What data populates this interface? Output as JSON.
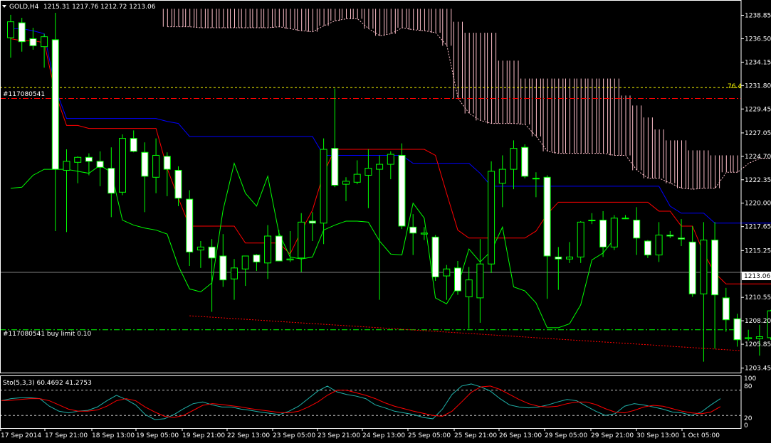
{
  "header": {
    "symbol": "GOLD,H4",
    "ohlc": "1215.31 1217.76 1212.72 1213.06"
  },
  "orders": {
    "sell_label": "#117080541",
    "buy_label": "#117080541 buy limit 0.10",
    "fib_label": "76.4"
  },
  "stoch": {
    "label": "Sto(5,3,3) 60.4692 41.2753",
    "levels": [
      100,
      80,
      20,
      0
    ]
  },
  "current_price": "1213.06",
  "colors": {
    "bull": "#00ff00",
    "bear_body": "#ffffff",
    "tenkan": "#ff0000",
    "kijun": "#0000ff",
    "chikou": "#00ff00",
    "kumo": "#ffc0cb",
    "grid_line": "#808080",
    "stoch_main": "#20b2aa",
    "stoch_signal": "#ff0000"
  },
  "chart_data": [
    {
      "type": "candlestick",
      "title": "GOLD,H4",
      "y_axis_labels": [
        "1238.85",
        "1236.50",
        "1234.15",
        "1231.80",
        "1229.45",
        "1227.05",
        "1224.70",
        "1222.35",
        "1220.00",
        "1217.65",
        "1215.25",
        "1213.06",
        "1210.55",
        "1208.20",
        "1205.85",
        "1203.45"
      ],
      "x_axis_labels": [
        "17 Sep 2014",
        "17 Sep 21:00",
        "18 Sep 13:00",
        "19 Sep 05:00",
        "19 Sep 21:00",
        "22 Sep 13:00",
        "23 Sep 05:00",
        "23 Sep 21:00",
        "24 Sep 13:00",
        "25 Sep 05:00",
        "25 Sep 21:00",
        "26 Sep 13:00",
        "29 Sep 05:00",
        "29 Sep 21:00",
        "30 Sep 13:00",
        "1 Oct 05:00"
      ],
      "ylim": [
        1203.0,
        1240.1
      ],
      "candles": [
        {
          "o": 1236.6,
          "h": 1238.9,
          "l": 1234.6,
          "c": 1238.2
        },
        {
          "o": 1238.1,
          "h": 1238.6,
          "l": 1235.2,
          "c": 1236.2
        },
        {
          "o": 1236.5,
          "h": 1237.6,
          "l": 1235.4,
          "c": 1235.8
        },
        {
          "o": 1235.7,
          "h": 1237.0,
          "l": 1233.6,
          "c": 1236.7
        },
        {
          "o": 1236.4,
          "h": 1239.1,
          "l": 1217.2,
          "c": 1223.4
        },
        {
          "o": 1223.3,
          "h": 1225.4,
          "l": 1217.1,
          "c": 1224.2
        },
        {
          "o": 1224.1,
          "h": 1224.7,
          "l": 1222.0,
          "c": 1224.6
        },
        {
          "o": 1224.6,
          "h": 1225.0,
          "l": 1222.8,
          "c": 1224.2
        },
        {
          "o": 1224.2,
          "h": 1225.2,
          "l": 1221.7,
          "c": 1223.6
        },
        {
          "o": 1223.5,
          "h": 1225.6,
          "l": 1218.6,
          "c": 1221.0
        },
        {
          "o": 1221.1,
          "h": 1226.9,
          "l": 1220.8,
          "c": 1226.5
        },
        {
          "o": 1226.5,
          "h": 1227.3,
          "l": 1225.1,
          "c": 1225.2
        },
        {
          "o": 1225.1,
          "h": 1226.1,
          "l": 1219.1,
          "c": 1222.7
        },
        {
          "o": 1222.6,
          "h": 1226.5,
          "l": 1221.0,
          "c": 1224.8
        },
        {
          "o": 1224.7,
          "h": 1225.1,
          "l": 1220.7,
          "c": 1223.4
        },
        {
          "o": 1223.3,
          "h": 1223.7,
          "l": 1219.7,
          "c": 1220.5
        },
        {
          "o": 1220.4,
          "h": 1221.3,
          "l": 1213.7,
          "c": 1215.1
        },
        {
          "o": 1215.3,
          "h": 1216.2,
          "l": 1213.5,
          "c": 1215.6
        },
        {
          "o": 1215.6,
          "h": 1216.4,
          "l": 1209.1,
          "c": 1214.5
        },
        {
          "o": 1214.7,
          "h": 1216.9,
          "l": 1211.6,
          "c": 1212.3
        },
        {
          "o": 1212.4,
          "h": 1214.4,
          "l": 1210.3,
          "c": 1213.5
        },
        {
          "o": 1213.4,
          "h": 1214.6,
          "l": 1211.7,
          "c": 1214.7
        },
        {
          "o": 1214.8,
          "h": 1214.9,
          "l": 1213.2,
          "c": 1214.1
        },
        {
          "o": 1214.0,
          "h": 1217.8,
          "l": 1212.4,
          "c": 1216.7
        },
        {
          "o": 1216.7,
          "h": 1217.3,
          "l": 1214.2,
          "c": 1214.2
        },
        {
          "o": 1214.3,
          "h": 1217.2,
          "l": 1214.1,
          "c": 1214.4
        },
        {
          "o": 1214.5,
          "h": 1219.0,
          "l": 1213.1,
          "c": 1218.1
        },
        {
          "o": 1218.2,
          "h": 1219.1,
          "l": 1216.2,
          "c": 1218.0
        },
        {
          "o": 1218.0,
          "h": 1226.5,
          "l": 1215.9,
          "c": 1225.4
        },
        {
          "o": 1225.5,
          "h": 1231.5,
          "l": 1221.6,
          "c": 1221.8
        },
        {
          "o": 1221.9,
          "h": 1222.6,
          "l": 1220.2,
          "c": 1222.2
        },
        {
          "o": 1222.1,
          "h": 1224.3,
          "l": 1221.9,
          "c": 1222.9
        },
        {
          "o": 1222.8,
          "h": 1225.4,
          "l": 1219.5,
          "c": 1223.5
        },
        {
          "o": 1223.4,
          "h": 1224.8,
          "l": 1210.3,
          "c": 1223.9
        },
        {
          "o": 1223.9,
          "h": 1225.2,
          "l": 1222.4,
          "c": 1224.9
        },
        {
          "o": 1224.8,
          "h": 1226.0,
          "l": 1217.4,
          "c": 1217.7
        },
        {
          "o": 1217.6,
          "h": 1218.9,
          "l": 1214.8,
          "c": 1217.0
        },
        {
          "o": 1216.9,
          "h": 1217.6,
          "l": 1216.3,
          "c": 1217.0
        },
        {
          "o": 1216.6,
          "h": 1216.8,
          "l": 1212.2,
          "c": 1212.6
        },
        {
          "o": 1212.7,
          "h": 1213.8,
          "l": 1210.3,
          "c": 1213.4
        },
        {
          "o": 1213.5,
          "h": 1214.2,
          "l": 1210.8,
          "c": 1211.2
        },
        {
          "o": 1210.6,
          "h": 1213.6,
          "l": 1207.4,
          "c": 1212.3
        },
        {
          "o": 1210.5,
          "h": 1216.4,
          "l": 1208.0,
          "c": 1213.9
        },
        {
          "o": 1213.9,
          "h": 1224.2,
          "l": 1213.0,
          "c": 1223.2
        },
        {
          "o": 1222.0,
          "h": 1224.8,
          "l": 1219.6,
          "c": 1223.4
        },
        {
          "o": 1223.4,
          "h": 1226.3,
          "l": 1221.4,
          "c": 1225.5
        },
        {
          "o": 1225.6,
          "h": 1225.9,
          "l": 1222.5,
          "c": 1222.7
        },
        {
          "o": 1222.5,
          "h": 1223.1,
          "l": 1220.6,
          "c": 1222.5
        },
        {
          "o": 1222.6,
          "h": 1222.8,
          "l": 1210.4,
          "c": 1214.7
        },
        {
          "o": 1214.6,
          "h": 1215.6,
          "l": 1211.3,
          "c": 1214.4
        },
        {
          "o": 1214.4,
          "h": 1216.1,
          "l": 1214.0,
          "c": 1214.6
        },
        {
          "o": 1214.6,
          "h": 1218.2,
          "l": 1214.0,
          "c": 1218.1
        },
        {
          "o": 1218.3,
          "h": 1219.0,
          "l": 1217.9,
          "c": 1218.3
        },
        {
          "o": 1218.3,
          "h": 1219.2,
          "l": 1214.6,
          "c": 1215.6
        },
        {
          "o": 1215.6,
          "h": 1218.8,
          "l": 1215.3,
          "c": 1218.5
        },
        {
          "o": 1218.5,
          "h": 1218.8,
          "l": 1218.4,
          "c": 1218.5
        },
        {
          "o": 1218.3,
          "h": 1219.6,
          "l": 1214.8,
          "c": 1216.5
        },
        {
          "o": 1216.2,
          "h": 1216.3,
          "l": 1214.5,
          "c": 1214.8
        },
        {
          "o": 1214.8,
          "h": 1218.1,
          "l": 1214.1,
          "c": 1216.8
        },
        {
          "o": 1216.8,
          "h": 1217.2,
          "l": 1216.5,
          "c": 1216.7
        },
        {
          "o": 1216.5,
          "h": 1218.4,
          "l": 1215.7,
          "c": 1216.4
        },
        {
          "o": 1216.1,
          "h": 1217.7,
          "l": 1210.6,
          "c": 1210.9
        },
        {
          "o": 1210.9,
          "h": 1218.1,
          "l": 1204.1,
          "c": 1216.3
        },
        {
          "o": 1216.3,
          "h": 1218.1,
          "l": 1205.4,
          "c": 1210.8
        },
        {
          "o": 1210.5,
          "h": 1211.5,
          "l": 1207.1,
          "c": 1208.3
        },
        {
          "o": 1208.4,
          "h": 1208.9,
          "l": 1205.6,
          "c": 1206.3
        },
        {
          "o": 1206.4,
          "h": 1207.3,
          "l": 1206.2,
          "c": 1206.5
        },
        {
          "o": 1206.4,
          "h": 1207.8,
          "l": 1204.7,
          "c": 1206.6
        },
        {
          "o": 1206.5,
          "h": 1209.3,
          "l": 1206.3,
          "c": 1209.2
        },
        {
          "o": 1209.1,
          "h": 1217.6,
          "l": 1207.9,
          "c": 1214.4
        },
        {
          "o": 1215.3,
          "h": 1217.8,
          "l": 1212.7,
          "c": 1213.1
        }
      ],
      "tenkan": [
        1236.5,
        1236.3,
        1236.3,
        1236.1,
        1231.0,
        1227.8,
        1227.8,
        1227.5,
        1227.5,
        1227.5,
        1227.5,
        1227.5,
        1227.5,
        1227.5,
        1223.5,
        1220.5,
        1217.7,
        1217.7,
        1217.7,
        1217.7,
        1217.7,
        1216.0,
        1216.0,
        1216.0,
        1216.0,
        1214.9,
        1217.2,
        1219.3,
        1223.0,
        1225.4,
        1225.4,
        1225.4,
        1225.4,
        1225.4,
        1225.4,
        1225.4,
        1225.4,
        1225.4,
        1224.8,
        1221.0,
        1217.3,
        1216.5,
        1216.5,
        1216.5,
        1216.5,
        1216.5,
        1216.5,
        1217.2,
        1218.9,
        1220.1,
        1220.1,
        1220.1,
        1220.1,
        1220.1,
        1220.1,
        1220.1,
        1220.1,
        1220.1,
        1219.2,
        1219.2,
        1217.7,
        1217.7,
        1215.0,
        1213.0,
        1211.9,
        1211.9,
        1211.9,
        1211.9,
        1211.9,
        1211.9,
        1212.2
      ],
      "kijun": [
        1237.5,
        1237.5,
        1237.3,
        1237.0,
        1231.5,
        1228.5,
        1228.5,
        1228.5,
        1228.5,
        1228.5,
        1228.5,
        1228.5,
        1228.5,
        1228.5,
        1228.2,
        1228.0,
        1226.7,
        1226.7,
        1226.7,
        1226.7,
        1226.7,
        1226.7,
        1226.7,
        1226.7,
        1226.7,
        1226.7,
        1226.7,
        1226.7,
        1224.8,
        1224.8,
        1224.8,
        1224.8,
        1224.8,
        1224.8,
        1224.8,
        1224.8,
        1224.0,
        1224.0,
        1224.0,
        1224.0,
        1224.0,
        1224.0,
        1223.0,
        1221.7,
        1221.7,
        1221.7,
        1221.7,
        1221.7,
        1221.7,
        1221.7,
        1221.7,
        1221.7,
        1221.7,
        1221.7,
        1221.7,
        1221.7,
        1221.7,
        1221.7,
        1221.7,
        1219.7,
        1219.0,
        1219.0,
        1219.0,
        1218.0,
        1218.0,
        1218.0,
        1218.0,
        1218.0,
        1218.0,
        1218.0,
        1217.9
      ],
      "chikou": [
        1221.5,
        1221.6,
        1222.8,
        1223.4,
        1223.4,
        1223.4,
        1223.2,
        1223.0,
        1223.8,
        1223.1,
        1218.3,
        1217.8,
        1217.5,
        1217.3,
        1216.9,
        1213.7,
        1211.4,
        1211.1,
        1212.0,
        1219.3,
        1224.0,
        1221.0,
        1219.7,
        1222.7,
        1217.0,
        1214.6,
        1214.4,
        1214.6,
        1217.3,
        1217.8,
        1218.2,
        1218.2,
        1218.1,
        1216.2,
        1214.9,
        1214.8,
        1220.0,
        1218.5,
        1210.5,
        1209.9,
        1211.7,
        1215.4,
        1214.1,
        1215.2,
        1217.6,
        1211.6,
        1211.2,
        1210.0,
        1207.5,
        1207.5,
        1207.9,
        1209.8,
        1214.3,
        1215.0,
        1216.4
      ],
      "kumo_top": [
        null,
        null,
        null,
        null,
        null,
        null,
        null,
        null,
        null,
        null,
        null,
        null,
        null,
        null,
        1239.5,
        1239.5,
        1239.5,
        1239.5,
        1239.5,
        1239.5,
        1239.5,
        1239.5,
        1239.5,
        1239.5,
        1239.5,
        1239.5,
        1239.5,
        1239.5,
        1239.5,
        1239.5,
        1239.5,
        1239.5,
        1239.5,
        1239.5,
        1239.5,
        1239.5,
        1239.5,
        1239.5,
        1239.5,
        1239.5,
        1238.2,
        1237.1,
        1237.1,
        1237.1,
        1234.3,
        1234.3,
        1232.5,
        1232.5,
        1232.5,
        1232.5,
        1232.5,
        1232.5,
        1232.5,
        1232.5,
        1232.5,
        1230.8,
        1229.8,
        1228.6,
        1227.4,
        1226.3,
        1226.3,
        1225.3,
        1225.3,
        1224.8,
        1224.8,
        1224.8,
        1224.8,
        1224.8,
        1224.8,
        1224.8,
        1224.8,
        1224.8,
        1224.8,
        1224.8
      ],
      "kumo_bottom": [
        null,
        null,
        null,
        null,
        null,
        null,
        null,
        null,
        null,
        null,
        null,
        null,
        null,
        null,
        1237.7,
        1237.7,
        1237.7,
        1237.6,
        1237.6,
        1237.6,
        1237.6,
        1237.6,
        1237.6,
        1237.6,
        1237.7,
        1237.5,
        1237.3,
        1237.2,
        1237.8,
        1238.3,
        1238.5,
        1238.5,
        1237.5,
        1236.8,
        1237.0,
        1237.6,
        1237.4,
        1237.3,
        1237.1,
        1235.8,
        1230.5,
        1229.0,
        1228.3,
        1228.0,
        1228.0,
        1228.0,
        1227.9,
        1226.7,
        1225.2,
        1225.0,
        1225.0,
        1225.0,
        1225.0,
        1225.0,
        1224.8,
        1224.8,
        1223.3,
        1222.5,
        1222.5,
        1222.0,
        1221.5,
        1221.4,
        1221.5,
        1221.5,
        1223.1,
        1223.1,
        1224.0,
        1224.5,
        1224.5,
        1223.9,
        1224.0,
        1224.1,
        1222.2,
        1219.6,
        1217.9,
        1217.6,
        1217.6,
        1217.6
      ],
      "hlines": {
        "fib": 1231.6,
        "sell": 1230.5,
        "buy_limit": 1207.3,
        "bid": 1213.06
      },
      "trendline": {
        "from": [
          16,
          1208.7
        ],
        "to": [
          75,
          1205.2
        ]
      }
    },
    {
      "type": "line",
      "title": "Sto(5,3,3) 60.4692 41.2753",
      "ylim": [
        0,
        100
      ],
      "levels": [
        80,
        20
      ],
      "series": [
        {
          "name": "main",
          "values": [
            55,
            60,
            62,
            62,
            60,
            42,
            30,
            26,
            30,
            32,
            40,
            55,
            68,
            58,
            45,
            22,
            10,
            12,
            22,
            36,
            48,
            52,
            45,
            40,
            40,
            35,
            32,
            28,
            25,
            22,
            30,
            42,
            60,
            78,
            90,
            76,
            70,
            66,
            60,
            45,
            38,
            30,
            26,
            22,
            15,
            12,
            35,
            70,
            90,
            95,
            88,
            78,
            60,
            45,
            40,
            38,
            40,
            45,
            52,
            58,
            55,
            42,
            30,
            20,
            24,
            42,
            48,
            45,
            40,
            35,
            28,
            26,
            20,
            28,
            45,
            60
          ]
        },
        {
          "name": "signal",
          "values": [
            55,
            56,
            58,
            60,
            60,
            55,
            45,
            35,
            30,
            30,
            33,
            42,
            55,
            60,
            55,
            40,
            28,
            18,
            15,
            20,
            32,
            44,
            48,
            46,
            43,
            40,
            36,
            33,
            30,
            27,
            26,
            30,
            40,
            52,
            68,
            80,
            80,
            74,
            68,
            60,
            50,
            42,
            36,
            30,
            25,
            20,
            18,
            30,
            52,
            75,
            88,
            90,
            82,
            70,
            58,
            48,
            42,
            40,
            42,
            48,
            52,
            52,
            46,
            36,
            28,
            26,
            32,
            40,
            44,
            42,
            36,
            30,
            26,
            24,
            28,
            41
          ]
        }
      ]
    }
  ]
}
